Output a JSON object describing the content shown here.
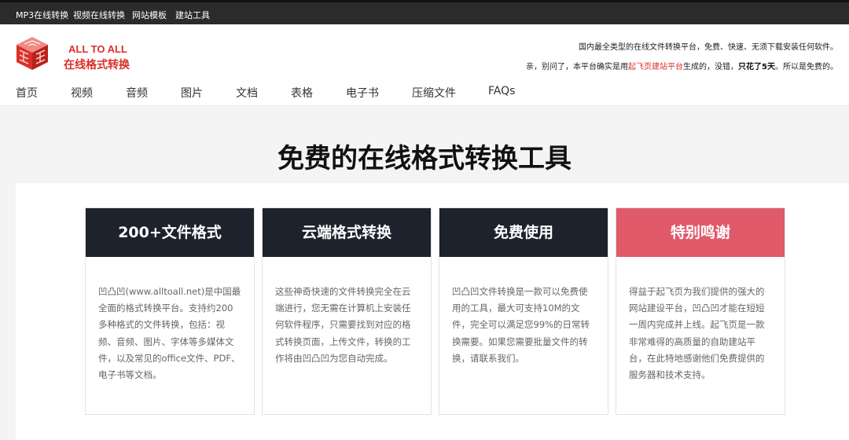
{
  "topbar": {
    "links": [
      "MP3在线转换",
      "视频在线转换",
      "网站模板",
      "建站工具"
    ]
  },
  "header": {
    "brand_en": "ALL TO ALL",
    "brand_cn": "在线格式转换",
    "tagline1": "国内最全类型的在线文件转换平台，免费、快速、无须下载安装任何软件。",
    "tagline2_prefix": "亲，别问了，本平台确实是用",
    "tagline2_link": "起飞页建站平台",
    "tagline2_mid": "生成的，没错，",
    "tagline2_bold": "只花了5天",
    "tagline2_suffix": "。所以是免费的。"
  },
  "nav": {
    "items": [
      "首页",
      "视频",
      "音频",
      "图片",
      "文档",
      "表格",
      "电子书",
      "压缩文件",
      "FAQs"
    ]
  },
  "hero": {
    "title": "免费的在线格式转换工具"
  },
  "cards": [
    {
      "title": "200+文件格式",
      "body": "凹凸凹(www.alltoall.net)是中国最全面的格式转换平台。支持约200多种格式的文件转换，包括：视频、音频、图片、字体等多媒体文件，以及常见的office文件、PDF、电子书等文档。"
    },
    {
      "title": "云端格式转换",
      "body": "这些神奇快速的文件转换完全在云端进行，您无需在计算机上安装任何软件程序，只需要找到对应的格式转换页面，上传文件，转换的工作将由凹凸凹为您自动完成。"
    },
    {
      "title": "免费使用",
      "body": "凹凸凹文件转换是一款可以免费使用的工具，最大可支持10M的文件，完全可以满足您99%的日常转换需要。如果您需要批量文件的转换，请联系我们。"
    },
    {
      "title": "特别鸣谢",
      "body": "得益于起飞页为我们提供的强大的网站建设平台，凹凸凹才能在短短一周内完成并上线。起飞页是一款非常难得的高质量的自助建站平台，在此特地感谢他们免费提供的服务器和技术支持。"
    }
  ],
  "colors": {
    "brand_red": "#d9302a",
    "card_dark": "#1d222c",
    "card_pink": "#e05a6a"
  }
}
